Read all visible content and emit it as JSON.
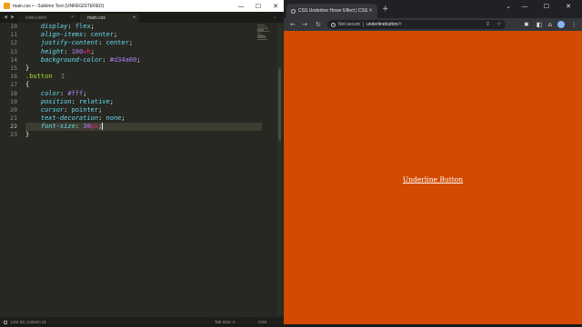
{
  "sublime": {
    "title": "main.css • - Sublime Text (UNREGISTERED)",
    "tabs": [
      {
        "label": "index.html",
        "active": false
      },
      {
        "label": "main.css",
        "active": true
      }
    ],
    "lines": [
      {
        "num": "10",
        "tokens": [
          [
            "ind",
            "    "
          ],
          [
            "prop",
            "display"
          ],
          [
            "punc",
            ": "
          ],
          [
            "val",
            "flex"
          ],
          [
            "punc",
            ";"
          ]
        ]
      },
      {
        "num": "11",
        "tokens": [
          [
            "ind",
            "    "
          ],
          [
            "prop",
            "align-items"
          ],
          [
            "punc",
            ": "
          ],
          [
            "val",
            "center"
          ],
          [
            "punc",
            ";"
          ]
        ]
      },
      {
        "num": "12",
        "tokens": [
          [
            "ind",
            "    "
          ],
          [
            "prop",
            "justify-content"
          ],
          [
            "punc",
            ": "
          ],
          [
            "val",
            "center"
          ],
          [
            "punc",
            ";"
          ]
        ]
      },
      {
        "num": "13",
        "tokens": [
          [
            "ind",
            "    "
          ],
          [
            "prop",
            "height"
          ],
          [
            "punc",
            ": "
          ],
          [
            "num",
            "100"
          ],
          [
            "unit",
            "vh"
          ],
          [
            "punc",
            ";"
          ]
        ]
      },
      {
        "num": "14",
        "tokens": [
          [
            "ind",
            "    "
          ],
          [
            "prop",
            "background-color"
          ],
          [
            "punc",
            ": "
          ],
          [
            "hex",
            "#d34a00"
          ],
          [
            "punc",
            ";"
          ]
        ]
      },
      {
        "num": "15",
        "tokens": [
          [
            "punc",
            "}"
          ]
        ]
      },
      {
        "num": "16",
        "tokens": [
          [
            "sel",
            ".button"
          ]
        ]
      },
      {
        "num": "17",
        "tokens": [
          [
            "punc",
            "{"
          ]
        ]
      },
      {
        "num": "18",
        "tokens": [
          [
            "ind",
            "    "
          ],
          [
            "prop",
            "color"
          ],
          [
            "punc",
            ": "
          ],
          [
            "hex",
            "#fff"
          ],
          [
            "punc",
            ";"
          ]
        ]
      },
      {
        "num": "19",
        "tokens": [
          [
            "ind",
            "    "
          ],
          [
            "prop",
            "position"
          ],
          [
            "punc",
            ": "
          ],
          [
            "val",
            "relative"
          ],
          [
            "punc",
            ";"
          ]
        ]
      },
      {
        "num": "20",
        "tokens": [
          [
            "ind",
            "    "
          ],
          [
            "prop",
            "cursor"
          ],
          [
            "punc",
            ": "
          ],
          [
            "val",
            "pointer"
          ],
          [
            "punc",
            ";"
          ]
        ]
      },
      {
        "num": "21",
        "tokens": [
          [
            "ind",
            "    "
          ],
          [
            "prop",
            "text-decoration"
          ],
          [
            "punc",
            ": "
          ],
          [
            "val",
            "none"
          ],
          [
            "punc",
            ";"
          ]
        ]
      },
      {
        "num": "22",
        "tokens": [
          [
            "ind",
            "    "
          ],
          [
            "prop",
            "font-size"
          ],
          [
            "punc",
            ": "
          ],
          [
            "num",
            "30"
          ],
          [
            "unit",
            "px"
          ],
          [
            "punc",
            ";"
          ]
        ],
        "current": true
      },
      {
        "num": "23",
        "tokens": [
          [
            "punc",
            "}"
          ]
        ]
      }
    ],
    "status": {
      "position": "Line 22, Column 21",
      "tab_size": "Tab Size: 4",
      "syntax": "CSS"
    }
  },
  "chrome": {
    "tab_title": "CSS Underline Hover Effect | CSS",
    "address": {
      "security": "Not secure",
      "host": "underlinebutton",
      "path": "/#"
    },
    "page": {
      "button_label": "Underline Button",
      "background": "#d34a00"
    }
  },
  "icons": {
    "window_minimize": "—",
    "window_maximize": "☐",
    "window_close": "✕",
    "back": "←",
    "forward": "→",
    "reload": "↻",
    "home": "⌂",
    "share": "⇪",
    "star": "☆",
    "extensions": "✱",
    "sidepanel": "◧",
    "menu": "⋮",
    "new_tab": "+",
    "tab_close": "×",
    "tab_left": "◀",
    "tab_right": "▶",
    "tab_add": "●",
    "chevron": "⌄"
  }
}
